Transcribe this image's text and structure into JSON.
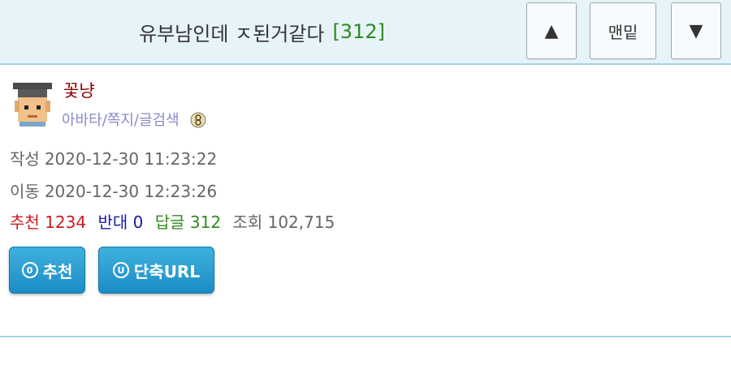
{
  "header": {
    "title": "유부남인데 ㅈ된거같다",
    "reply_count": "[312]",
    "up_label": "▲",
    "bottom_label": "맨밑",
    "down_label": "▼"
  },
  "author": {
    "name": "꽃냥",
    "links": [
      "아바타",
      "쪽지",
      "글검색"
    ],
    "link_separator": "/"
  },
  "meta": {
    "written_label": "작성",
    "written_time": "2020-12-30 11:23:22",
    "moved_label": "이동",
    "moved_time": "2020-12-30 12:23:26"
  },
  "stats": {
    "recommend_label": "추천",
    "recommend_value": "1234",
    "oppose_label": "반대",
    "oppose_value": "0",
    "reply_label": "답글",
    "reply_value": "312",
    "views_label": "조회",
    "views_value": "102,715"
  },
  "actions": {
    "recommend_icon_letter": "0",
    "recommend_label": "추천",
    "shorturl_icon_letter": "U",
    "shorturl_label": "단축URL"
  },
  "colors": {
    "header_bg": "#e6f3f9",
    "accent_border": "#a9d3e6",
    "button_blue": "#1b8cc4",
    "recommend_red": "#cc1b1b",
    "oppose_blue": "#1a1aa6",
    "reply_green": "#2f8a1e",
    "author_name": "#8b0000",
    "link_purple": "#8a8ac8"
  },
  "icons": {
    "avatar": "avatar-icon",
    "level": "level-badge-icon",
    "recommend": "recommend-circle-icon",
    "shorturl": "url-circle-icon"
  }
}
